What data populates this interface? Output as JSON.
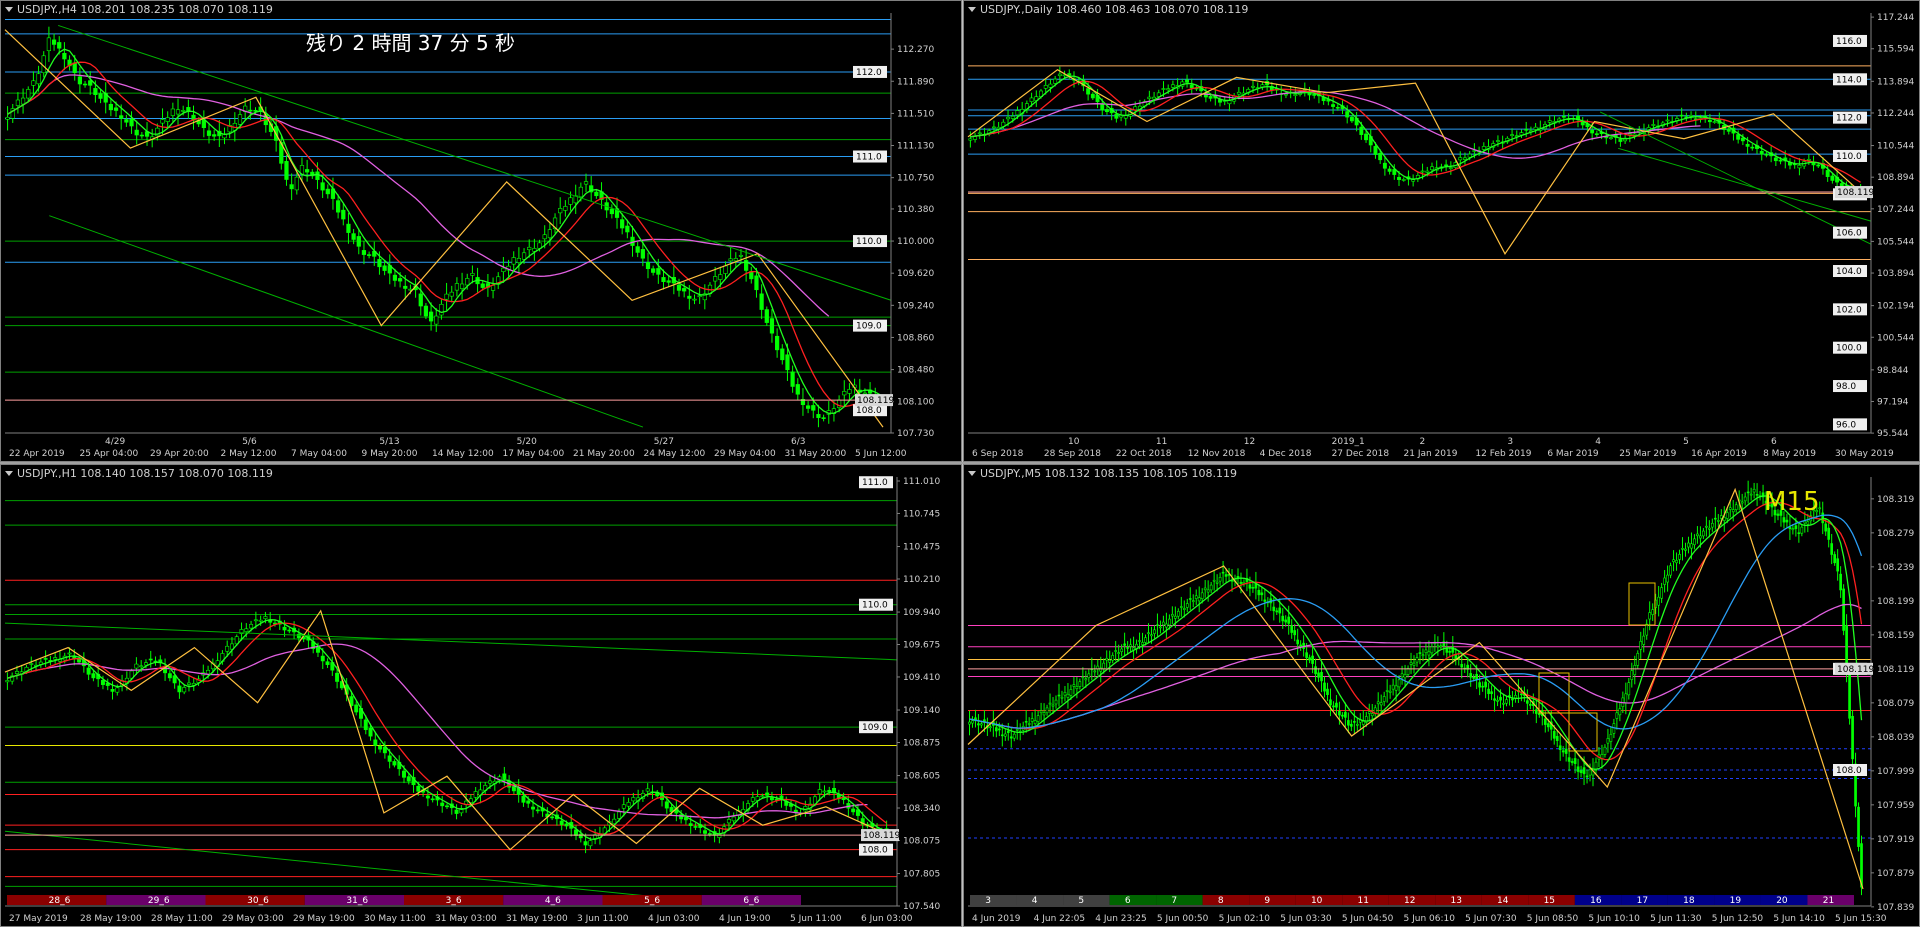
{
  "app": {
    "name": "MetaTrader 4"
  },
  "colors": {
    "background": "#000000",
    "grid_level": "#00a000",
    "bull": "#00ff00",
    "bear": "#00ff00",
    "ma_fast": "#ff0000",
    "ma_mid": "#00ff00",
    "ma_slow": "#e060e0",
    "zigzag": "#ffc040",
    "price_line": "#ff9090",
    "panel_border": "#808080"
  },
  "icons": {
    "window_menu": "triangle-down-icon"
  },
  "windows": [
    {
      "id": "h4",
      "title": "USDJPY.,H4  108.201 108.235 108.070 108.119",
      "countdown": "残り 2 時間 37 分 5 秒"
    },
    {
      "id": "daily",
      "title": "USDJPY.,Daily  108.460 108.463 108.070 108.119"
    },
    {
      "id": "h1",
      "title": "USDJPY.,H1  108.140 108.157 108.070 108.119"
    },
    {
      "id": "m5",
      "title": "USDJPY.,M5  108.132 108.135 108.105 108.119"
    }
  ],
  "chart_data": [
    {
      "type": "candlestick",
      "symbol": "USDJPY.",
      "timeframe": "H4",
      "title": "USDJPY.,H4  108.201 108.235 108.070 108.119",
      "ohlc_header": {
        "open": 108.201,
        "high": 108.235,
        "low": 108.07,
        "close": 108.119
      },
      "ylim": [
        107.73,
        112.65
      ],
      "y_ticks": [
        112.27,
        111.89,
        111.51,
        111.13,
        110.75,
        110.38,
        110.0,
        109.62,
        109.24,
        108.86,
        108.48,
        108.1,
        107.73
      ],
      "y_tick_labels": [
        "112.270",
        "111.890",
        "111.510",
        "111.130",
        "110.750",
        "110.380",
        "110.000",
        "109.620",
        "109.240",
        "108.860",
        "108.480",
        "108.100",
        "107.730"
      ],
      "x_labels": [
        "22 Apr 2019",
        "25 Apr 04:00",
        "29 Apr 20:00",
        "2 May 12:00",
        "7 May 04:00",
        "9 May 20:00",
        "14 May 12:00",
        "17 May 04:00",
        "21 May 20:00",
        "24 May 12:00",
        "29 May 04:00",
        "31 May 20:00",
        "5 Jun 12:00"
      ],
      "period_labels": [
        "4/29",
        "5/6",
        "5/13",
        "5/20",
        "5/27",
        "6/3"
      ],
      "level_labels": [
        {
          "text": "112.0",
          "value": 112.0
        },
        {
          "text": "111.0",
          "value": 111.0
        },
        {
          "text": "110.0",
          "value": 110.0
        },
        {
          "text": "109.0",
          "value": 109.0
        },
        {
          "text": "108.0",
          "value": 108.0
        }
      ],
      "current_price": {
        "text": "108.119",
        "value": 108.119
      },
      "zigzag": [
        112.5,
        111.1,
        111.7,
        109.0,
        110.7,
        109.3,
        109.85,
        107.8
      ],
      "close": [
        111.5,
        111.7,
        111.9,
        112.4,
        112.2,
        111.9,
        111.8,
        111.6,
        111.5,
        111.3,
        111.2,
        111.4,
        111.6,
        111.5,
        111.3,
        111.2,
        111.4,
        111.6,
        111.5,
        111.2,
        110.6,
        110.9,
        110.7,
        110.5,
        110.2,
        109.9,
        109.8,
        109.6,
        109.5,
        109.4,
        109.0,
        109.3,
        109.5,
        109.6,
        109.4,
        109.6,
        109.8,
        109.9,
        110.0,
        110.3,
        110.5,
        110.7,
        110.5,
        110.3,
        110.1,
        109.8,
        109.6,
        109.5,
        109.4,
        109.3,
        109.5,
        109.7,
        109.85,
        109.5,
        109.0,
        108.6,
        108.2,
        108.0,
        107.9,
        108.1,
        108.3,
        108.2,
        108.12
      ]
    },
    {
      "type": "candlestick",
      "symbol": "USDJPY.",
      "timeframe": "Daily",
      "title": "USDJPY.,Daily  108.460 108.463 108.070 108.119",
      "ohlc_header": {
        "open": 108.46,
        "high": 108.463,
        "low": 108.07,
        "close": 108.119
      },
      "ylim": [
        95.55,
        117.25
      ],
      "y_ticks": [
        117.244,
        115.594,
        113.894,
        112.244,
        110.544,
        108.894,
        107.244,
        105.544,
        103.894,
        102.194,
        100.544,
        98.844,
        97.194,
        95.544
      ],
      "y_tick_labels": [
        "117.244",
        "115.594",
        "113.894",
        "112.244",
        "110.544",
        "108.894",
        "107.244",
        "105.544",
        "103.894",
        "102.194",
        "100.544",
        "98.844",
        "97.194",
        "95.544"
      ],
      "x_labels": [
        "6 Sep 2018",
        "28 Sep 2018",
        "22 Oct 2018",
        "12 Nov 2018",
        "4 Dec 2018",
        "27 Dec 2018",
        "21 Jan 2019",
        "12 Feb 2019",
        "6 Mar 2019",
        "25 Mar 2019",
        "16 Apr 2019",
        "8 May 2019",
        "30 May 2019"
      ],
      "period_labels": [
        "10",
        "11",
        "12",
        "2019_1",
        "2",
        "3",
        "4",
        "5",
        "6"
      ],
      "level_labels": [
        {
          "text": "116.0",
          "value": 116.0
        },
        {
          "text": "114.0",
          "value": 114.0
        },
        {
          "text": "112.0",
          "value": 112.0
        },
        {
          "text": "110.0",
          "value": 110.0
        },
        {
          "text": "108.0",
          "value": 108.0
        },
        {
          "text": "106.0",
          "value": 106.0
        },
        {
          "text": "104.0",
          "value": 104.0
        },
        {
          "text": "102.0",
          "value": 102.0
        },
        {
          "text": "100.0",
          "value": 100.0
        },
        {
          "text": "98.0",
          "value": 98.0
        },
        {
          "text": "96.0",
          "value": 96.0
        }
      ],
      "current_price": {
        "text": "108.119",
        "value": 108.119
      },
      "zigzag": [
        111.0,
        114.5,
        111.8,
        114.1,
        113.3,
        113.8,
        104.9,
        111.8,
        110.9,
        112.2,
        108.0
      ],
      "close": [
        111.0,
        111.2,
        111.5,
        112.0,
        112.6,
        113.2,
        113.8,
        114.3,
        114.0,
        113.2,
        112.4,
        112.0,
        112.3,
        112.8,
        113.2,
        113.6,
        113.9,
        113.5,
        113.0,
        112.8,
        113.2,
        113.5,
        113.7,
        113.4,
        113.2,
        113.4,
        113.1,
        112.8,
        112.4,
        111.6,
        110.6,
        109.6,
        108.9,
        108.7,
        109.1,
        109.5,
        109.4,
        109.9,
        110.2,
        110.6,
        110.8,
        111.1,
        111.3,
        111.6,
        111.9,
        112.0,
        111.7,
        111.2,
        111.0,
        110.8,
        111.2,
        111.5,
        111.7,
        111.9,
        112.1,
        112.0,
        111.8,
        111.3,
        110.8,
        110.4,
        110.0,
        109.7,
        109.5,
        109.8,
        109.4,
        108.6,
        108.3,
        108.12
      ]
    },
    {
      "type": "candlestick",
      "symbol": "USDJPY.",
      "timeframe": "H1",
      "title": "USDJPY.,H1  108.140 108.157 108.070 108.119",
      "ohlc_header": {
        "open": 108.14,
        "high": 108.157,
        "low": 108.07,
        "close": 108.119
      },
      "ylim": [
        107.54,
        111.01
      ],
      "y_ticks": [
        111.01,
        110.745,
        110.475,
        110.21,
        109.94,
        109.675,
        109.41,
        109.14,
        108.875,
        108.605,
        108.34,
        108.075,
        107.805,
        107.54
      ],
      "y_tick_labels": [
        "111.010",
        "110.745",
        "110.475",
        "110.210",
        "109.940",
        "109.675",
        "109.410",
        "109.140",
        "108.875",
        "108.605",
        "108.340",
        "108.075",
        "107.805",
        "107.540"
      ],
      "x_labels": [
        "27 May 2019",
        "28 May 19:00",
        "28 May 11:00",
        "29 May 03:00",
        "29 May 19:00",
        "30 May 11:00",
        "31 May 03:00",
        "31 May 19:00",
        "3 Jun 11:00",
        "4 Jun 03:00",
        "4 Jun 19:00",
        "5 Jun 11:00",
        "6 Jun 03:00"
      ],
      "session_labels": [
        "28_6",
        "29_6",
        "30_6",
        "31_6",
        "3_6",
        "4_6",
        "5_6",
        "6_6"
      ],
      "level_labels": [
        {
          "text": "111.0",
          "value": 111.0
        },
        {
          "text": "110.0",
          "value": 110.0
        },
        {
          "text": "109.0",
          "value": 109.0
        },
        {
          "text": "108.0",
          "value": 108.0
        }
      ],
      "current_price": {
        "text": "108.119",
        "value": 108.119
      },
      "zigzag": [
        109.45,
        109.65,
        109.3,
        109.65,
        109.2,
        109.95,
        108.3,
        108.6,
        108.0,
        108.45,
        108.05,
        108.5,
        108.2,
        108.35,
        108.12
      ],
      "close": [
        109.4,
        109.5,
        109.55,
        109.6,
        109.4,
        109.3,
        109.5,
        109.55,
        109.3,
        109.4,
        109.6,
        109.8,
        109.9,
        109.8,
        109.7,
        109.5,
        109.2,
        108.9,
        108.7,
        108.5,
        108.4,
        108.3,
        108.5,
        108.6,
        108.4,
        108.3,
        108.2,
        108.05,
        108.2,
        108.4,
        108.5,
        108.3,
        108.2,
        108.1,
        108.3,
        108.45,
        108.4,
        108.3,
        108.5,
        108.4,
        108.2,
        108.12
      ]
    },
    {
      "type": "candlestick",
      "symbol": "USDJPY.",
      "timeframe": "M5",
      "title": "USDJPY.,M5  108.132 108.135 108.105 108.119",
      "ohlc_header": {
        "open": 108.132,
        "high": 108.135,
        "low": 108.105,
        "close": 108.119
      },
      "ylim": [
        107.84,
        108.34
      ],
      "y_ticks": [
        108.319,
        108.279,
        108.239,
        108.199,
        108.159,
        108.119,
        108.079,
        108.039,
        107.999,
        107.959,
        107.919,
        107.879,
        107.839
      ],
      "y_tick_labels": [
        "108.319",
        "108.279",
        "108.239",
        "108.199",
        "108.159",
        "108.119",
        "108.079",
        "108.039",
        "107.999",
        "107.959",
        "107.919",
        "107.879",
        "107.839"
      ],
      "x_labels": [
        "4 Jun 2019",
        "4 Jun 22:05",
        "4 Jun 23:25",
        "5 Jun 00:50",
        "5 Jun 02:10",
        "5 Jun 03:30",
        "5 Jun 04:50",
        "5 Jun 06:10",
        "5 Jun 07:30",
        "5 Jun 08:50",
        "5 Jun 10:10",
        "5 Jun 11:30",
        "5 Jun 12:50",
        "5 Jun 14:10",
        "5 Jun 15:30"
      ],
      "hour_labels": [
        "3",
        "4",
        "5",
        "6",
        "7",
        "8",
        "9",
        "10",
        "11",
        "12",
        "13",
        "14",
        "15",
        "16",
        "17",
        "18",
        "19",
        "20",
        "21"
      ],
      "level_labels": [
        {
          "text": "108.119",
          "value": 108.119
        },
        {
          "text": "108.0",
          "value": 108.0
        }
      ],
      "current_price": {
        "text": "108.119",
        "value": 108.119
      },
      "annotation": "M15",
      "zigzag": [
        108.03,
        108.17,
        108.24,
        108.04,
        108.15,
        107.98,
        108.33,
        107.86
      ],
      "close": [
        108.06,
        108.05,
        108.04,
        108.06,
        108.08,
        108.1,
        108.12,
        108.14,
        108.15,
        108.17,
        108.19,
        108.21,
        108.23,
        108.22,
        108.2,
        108.17,
        108.13,
        108.08,
        108.05,
        108.07,
        108.1,
        108.13,
        108.15,
        108.13,
        108.1,
        108.08,
        108.09,
        108.06,
        108.02,
        107.99,
        108.03,
        108.1,
        108.18,
        108.24,
        108.27,
        108.29,
        108.31,
        108.33,
        108.3,
        108.28,
        108.31,
        108.22,
        107.86
      ]
    }
  ]
}
